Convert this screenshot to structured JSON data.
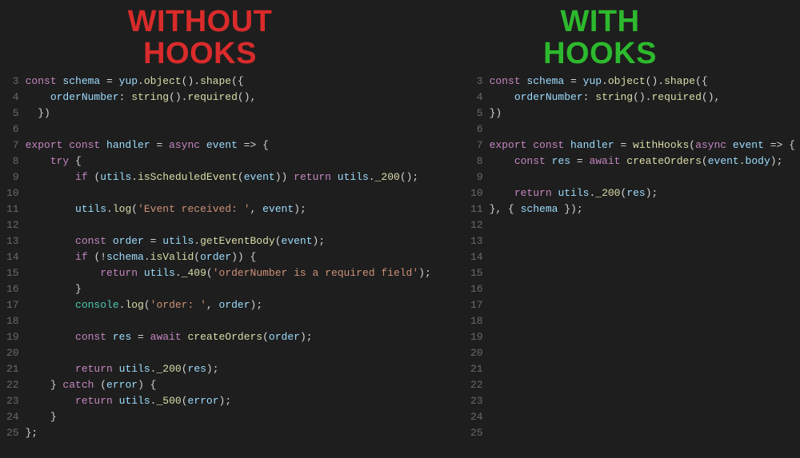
{
  "headings": {
    "left_line1": "WITHOUT",
    "left_line2": "HOOKS",
    "right_line1": "WITH",
    "right_line2": "HOOKS"
  },
  "left_panel": {
    "line_numbers": [
      "3",
      "4",
      "5",
      "6",
      "7",
      "8",
      "9",
      "10",
      "11",
      "12",
      "13",
      "14",
      "15",
      "16",
      "17",
      "18",
      "19",
      "20",
      "21",
      "22",
      "23",
      "24",
      "25"
    ],
    "lines": [
      [
        {
          "t": "const ",
          "c": "kw"
        },
        {
          "t": "schema",
          "c": "id"
        },
        {
          "t": " = ",
          "c": "op"
        },
        {
          "t": "yup",
          "c": "id"
        },
        {
          "t": ".",
          "c": "pn"
        },
        {
          "t": "object",
          "c": "fn"
        },
        {
          "t": "().",
          "c": "pn"
        },
        {
          "t": "shape",
          "c": "fn"
        },
        {
          "t": "({",
          "c": "pn"
        }
      ],
      [
        {
          "t": "    ",
          "c": "pn"
        },
        {
          "t": "orderNumber",
          "c": "id"
        },
        {
          "t": ": ",
          "c": "pn"
        },
        {
          "t": "string",
          "c": "fn"
        },
        {
          "t": "().",
          "c": "pn"
        },
        {
          "t": "required",
          "c": "fn"
        },
        {
          "t": "(),",
          "c": "pn"
        }
      ],
      [
        {
          "t": "  })",
          "c": "pn"
        }
      ],
      [
        {
          "t": " ",
          "c": "pn"
        }
      ],
      [
        {
          "t": "export ",
          "c": "kw"
        },
        {
          "t": "const ",
          "c": "kw"
        },
        {
          "t": "handler",
          "c": "id"
        },
        {
          "t": " = ",
          "c": "op"
        },
        {
          "t": "async ",
          "c": "kw"
        },
        {
          "t": "event",
          "c": "id"
        },
        {
          "t": " => {",
          "c": "pn"
        }
      ],
      [
        {
          "t": "    ",
          "c": "pn"
        },
        {
          "t": "try",
          "c": "kw"
        },
        {
          "t": " {",
          "c": "pn"
        }
      ],
      [
        {
          "t": "        ",
          "c": "pn"
        },
        {
          "t": "if",
          "c": "kw"
        },
        {
          "t": " (",
          "c": "pn"
        },
        {
          "t": "utils",
          "c": "id"
        },
        {
          "t": ".",
          "c": "pn"
        },
        {
          "t": "isScheduledEvent",
          "c": "fn"
        },
        {
          "t": "(",
          "c": "pn"
        },
        {
          "t": "event",
          "c": "id"
        },
        {
          "t": ")) ",
          "c": "pn"
        },
        {
          "t": "return",
          "c": "kw"
        },
        {
          "t": " ",
          "c": "pn"
        },
        {
          "t": "utils",
          "c": "id"
        },
        {
          "t": ".",
          "c": "pn"
        },
        {
          "t": "_200",
          "c": "fn"
        },
        {
          "t": "();",
          "c": "pn"
        }
      ],
      [
        {
          "t": " ",
          "c": "pn"
        }
      ],
      [
        {
          "t": "        ",
          "c": "pn"
        },
        {
          "t": "utils",
          "c": "id"
        },
        {
          "t": ".",
          "c": "pn"
        },
        {
          "t": "log",
          "c": "fn"
        },
        {
          "t": "(",
          "c": "pn"
        },
        {
          "t": "'Event received: '",
          "c": "str"
        },
        {
          "t": ", ",
          "c": "pn"
        },
        {
          "t": "event",
          "c": "id"
        },
        {
          "t": ");",
          "c": "pn"
        }
      ],
      [
        {
          "t": " ",
          "c": "pn"
        }
      ],
      [
        {
          "t": "        ",
          "c": "pn"
        },
        {
          "t": "const ",
          "c": "kw"
        },
        {
          "t": "order",
          "c": "id"
        },
        {
          "t": " = ",
          "c": "op"
        },
        {
          "t": "utils",
          "c": "id"
        },
        {
          "t": ".",
          "c": "pn"
        },
        {
          "t": "getEventBody",
          "c": "fn"
        },
        {
          "t": "(",
          "c": "pn"
        },
        {
          "t": "event",
          "c": "id"
        },
        {
          "t": ");",
          "c": "pn"
        }
      ],
      [
        {
          "t": "        ",
          "c": "pn"
        },
        {
          "t": "if",
          "c": "kw"
        },
        {
          "t": " (!",
          "c": "pn"
        },
        {
          "t": "schema",
          "c": "id"
        },
        {
          "t": ".",
          "c": "pn"
        },
        {
          "t": "isValid",
          "c": "fn"
        },
        {
          "t": "(",
          "c": "pn"
        },
        {
          "t": "order",
          "c": "id"
        },
        {
          "t": ")) {",
          "c": "pn"
        }
      ],
      [
        {
          "t": "            ",
          "c": "pn"
        },
        {
          "t": "return",
          "c": "kw"
        },
        {
          "t": " ",
          "c": "pn"
        },
        {
          "t": "utils",
          "c": "id"
        },
        {
          "t": ".",
          "c": "pn"
        },
        {
          "t": "_409",
          "c": "fn"
        },
        {
          "t": "(",
          "c": "pn"
        },
        {
          "t": "'orderNumber is a required field'",
          "c": "str"
        },
        {
          "t": ");",
          "c": "pn"
        }
      ],
      [
        {
          "t": "        }",
          "c": "pn"
        }
      ],
      [
        {
          "t": "        ",
          "c": "pn"
        },
        {
          "t": "console",
          "c": "cls"
        },
        {
          "t": ".",
          "c": "pn"
        },
        {
          "t": "log",
          "c": "fn"
        },
        {
          "t": "(",
          "c": "pn"
        },
        {
          "t": "'order: '",
          "c": "str"
        },
        {
          "t": ", ",
          "c": "pn"
        },
        {
          "t": "order",
          "c": "id"
        },
        {
          "t": ");",
          "c": "pn"
        }
      ],
      [
        {
          "t": " ",
          "c": "pn"
        }
      ],
      [
        {
          "t": "        ",
          "c": "pn"
        },
        {
          "t": "const ",
          "c": "kw"
        },
        {
          "t": "res",
          "c": "id"
        },
        {
          "t": " = ",
          "c": "op"
        },
        {
          "t": "await",
          "c": "kw"
        },
        {
          "t": " ",
          "c": "pn"
        },
        {
          "t": "createOrders",
          "c": "fn"
        },
        {
          "t": "(",
          "c": "pn"
        },
        {
          "t": "order",
          "c": "id"
        },
        {
          "t": ");",
          "c": "pn"
        }
      ],
      [
        {
          "t": " ",
          "c": "pn"
        }
      ],
      [
        {
          "t": "        ",
          "c": "pn"
        },
        {
          "t": "return",
          "c": "kw"
        },
        {
          "t": " ",
          "c": "pn"
        },
        {
          "t": "utils",
          "c": "id"
        },
        {
          "t": ".",
          "c": "pn"
        },
        {
          "t": "_200",
          "c": "fn"
        },
        {
          "t": "(",
          "c": "pn"
        },
        {
          "t": "res",
          "c": "id"
        },
        {
          "t": ");",
          "c": "pn"
        }
      ],
      [
        {
          "t": "    } ",
          "c": "pn"
        },
        {
          "t": "catch",
          "c": "kw"
        },
        {
          "t": " (",
          "c": "pn"
        },
        {
          "t": "error",
          "c": "id"
        },
        {
          "t": ") {",
          "c": "pn"
        }
      ],
      [
        {
          "t": "        ",
          "c": "pn"
        },
        {
          "t": "return",
          "c": "kw"
        },
        {
          "t": " ",
          "c": "pn"
        },
        {
          "t": "utils",
          "c": "id"
        },
        {
          "t": ".",
          "c": "pn"
        },
        {
          "t": "_500",
          "c": "fn"
        },
        {
          "t": "(",
          "c": "pn"
        },
        {
          "t": "error",
          "c": "id"
        },
        {
          "t": ");",
          "c": "pn"
        }
      ],
      [
        {
          "t": "    }",
          "c": "pn"
        }
      ],
      [
        {
          "t": "};",
          "c": "pn"
        }
      ]
    ]
  },
  "right_panel": {
    "line_numbers": [
      "3",
      "4",
      "5",
      "6",
      "7",
      "8",
      "9",
      "10",
      "11",
      "12",
      "13",
      "14",
      "15",
      "16",
      "17",
      "18",
      "19",
      "20",
      "21",
      "22",
      "23",
      "24",
      "25"
    ],
    "lines": [
      [
        {
          "t": "const ",
          "c": "kw"
        },
        {
          "t": "schema",
          "c": "id"
        },
        {
          "t": " = ",
          "c": "op"
        },
        {
          "t": "yup",
          "c": "id"
        },
        {
          "t": ".",
          "c": "pn"
        },
        {
          "t": "object",
          "c": "fn"
        },
        {
          "t": "().",
          "c": "pn"
        },
        {
          "t": "shape",
          "c": "fn"
        },
        {
          "t": "({",
          "c": "pn"
        }
      ],
      [
        {
          "t": "    ",
          "c": "pn"
        },
        {
          "t": "orderNumber",
          "c": "id"
        },
        {
          "t": ": ",
          "c": "pn"
        },
        {
          "t": "string",
          "c": "fn"
        },
        {
          "t": "().",
          "c": "pn"
        },
        {
          "t": "required",
          "c": "fn"
        },
        {
          "t": "(),",
          "c": "pn"
        }
      ],
      [
        {
          "t": "})",
          "c": "pn"
        }
      ],
      [
        {
          "t": " ",
          "c": "pn"
        }
      ],
      [
        {
          "t": "export ",
          "c": "kw"
        },
        {
          "t": "const ",
          "c": "kw"
        },
        {
          "t": "handler",
          "c": "id"
        },
        {
          "t": " = ",
          "c": "op"
        },
        {
          "t": "withHooks",
          "c": "fn"
        },
        {
          "t": "(",
          "c": "pn"
        },
        {
          "t": "async ",
          "c": "kw"
        },
        {
          "t": "event",
          "c": "id"
        },
        {
          "t": " => {",
          "c": "pn"
        }
      ],
      [
        {
          "t": "    ",
          "c": "pn"
        },
        {
          "t": "const ",
          "c": "kw"
        },
        {
          "t": "res",
          "c": "id"
        },
        {
          "t": " = ",
          "c": "op"
        },
        {
          "t": "await",
          "c": "kw"
        },
        {
          "t": " ",
          "c": "pn"
        },
        {
          "t": "createOrders",
          "c": "fn"
        },
        {
          "t": "(",
          "c": "pn"
        },
        {
          "t": "event",
          "c": "id"
        },
        {
          "t": ".",
          "c": "pn"
        },
        {
          "t": "body",
          "c": "id"
        },
        {
          "t": ");",
          "c": "pn"
        }
      ],
      [
        {
          "t": " ",
          "c": "pn"
        }
      ],
      [
        {
          "t": "    ",
          "c": "pn"
        },
        {
          "t": "return",
          "c": "kw"
        },
        {
          "t": " ",
          "c": "pn"
        },
        {
          "t": "utils",
          "c": "id"
        },
        {
          "t": ".",
          "c": "pn"
        },
        {
          "t": "_200",
          "c": "fn"
        },
        {
          "t": "(",
          "c": "pn"
        },
        {
          "t": "res",
          "c": "id"
        },
        {
          "t": ");",
          "c": "pn"
        }
      ],
      [
        {
          "t": "}, { ",
          "c": "pn"
        },
        {
          "t": "schema",
          "c": "id"
        },
        {
          "t": " });",
          "c": "pn"
        }
      ],
      [
        {
          "t": " ",
          "c": "pn"
        }
      ],
      [
        {
          "t": " ",
          "c": "pn"
        }
      ],
      [
        {
          "t": " ",
          "c": "pn"
        }
      ],
      [
        {
          "t": " ",
          "c": "pn"
        }
      ],
      [
        {
          "t": " ",
          "c": "pn"
        }
      ],
      [
        {
          "t": " ",
          "c": "pn"
        }
      ],
      [
        {
          "t": " ",
          "c": "pn"
        }
      ],
      [
        {
          "t": " ",
          "c": "pn"
        }
      ],
      [
        {
          "t": " ",
          "c": "pn"
        }
      ],
      [
        {
          "t": " ",
          "c": "pn"
        }
      ],
      [
        {
          "t": " ",
          "c": "pn"
        }
      ],
      [
        {
          "t": " ",
          "c": "pn"
        }
      ],
      [
        {
          "t": " ",
          "c": "pn"
        }
      ],
      [
        {
          "t": " ",
          "c": "pn"
        }
      ]
    ]
  }
}
